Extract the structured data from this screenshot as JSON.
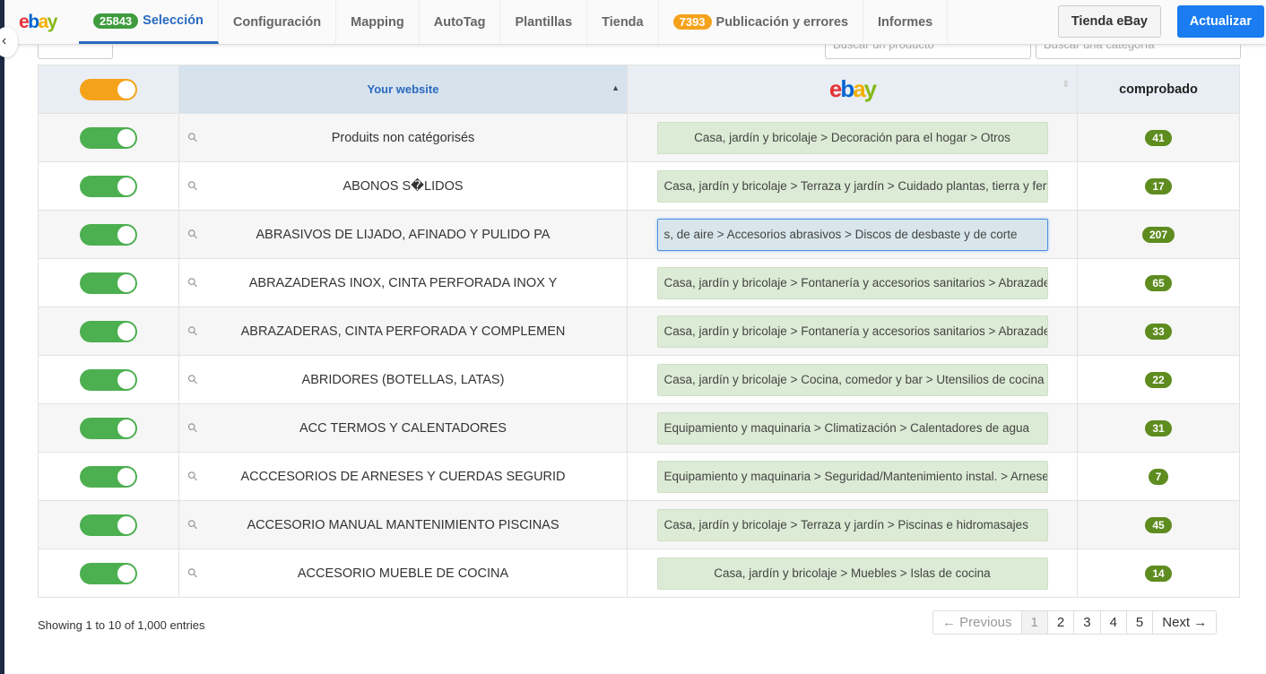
{
  "nav": {
    "logo": "ebay",
    "tabs": [
      {
        "label": "Selección",
        "badge": "25843",
        "badge_color": "#3e9b3e",
        "active": true
      },
      {
        "label": "Configuración"
      },
      {
        "label": "Mapping"
      },
      {
        "label": "AutoTag"
      },
      {
        "label": "Plantillas"
      },
      {
        "label": "Tienda"
      },
      {
        "label": "Publicación y errores",
        "badge": "7393",
        "badge_color": "#f5a21b"
      },
      {
        "label": "Informes"
      }
    ],
    "store_button": "Tienda eBay",
    "update_button": "Actualizar"
  },
  "search": {
    "product_placeholder": "Buscar un producto",
    "category_placeholder": "Buscar una categoría"
  },
  "table": {
    "header": {
      "site": "Your website",
      "ebay": "ebay",
      "checked": "comprobado"
    },
    "rows": [
      {
        "name": "Produits non catégorisés",
        "category": "Casa, jardín y bricolaje > Decoración para el hogar > Otros",
        "count": "41"
      },
      {
        "name": "ABONOS S�LIDOS",
        "category": "Casa, jardín y bricolaje > Terraza y jardín > Cuidado plantas, tierra y fertilizantes",
        "count": "17"
      },
      {
        "name": "ABRASIVOS DE LIJADO, AFINADO Y PULIDO PA",
        "category": "s, de aire > Accesorios abrasivos > Discos de desbaste y de corte",
        "count": "207"
      },
      {
        "name": "ABRAZADERAS INOX, CINTA PERFORADA INOX Y",
        "category": "Casa, jardín y bricolaje > Fontanería y accesorios sanitarios > Abrazaderas",
        "count": "65"
      },
      {
        "name": "ABRAZADERAS, CINTA PERFORADA Y COMPLEMEN",
        "category": "Casa, jardín y bricolaje > Fontanería y accesorios sanitarios > Abrazaderas",
        "count": "33"
      },
      {
        "name": "ABRIDORES (BOTELLAS, LATAS)",
        "category": "Casa, jardín y bricolaje > Cocina, comedor y bar > Utensilios de cocina",
        "count": "22"
      },
      {
        "name": "ACC TERMOS Y CALENTADORES",
        "category": "Equipamiento y maquinaria > Climatización > Calentadores de agua",
        "count": "31"
      },
      {
        "name": "ACCCESORIOS DE ARNESES Y CUERDAS SEGURID",
        "category": "Equipamiento y maquinaria > Seguridad/Mantenimiento instal. > Arneses",
        "count": "7"
      },
      {
        "name": "ACCESORIO MANUAL MANTENIMIENTO PISCINAS",
        "category": "Casa, jardín y bricolaje > Terraza y jardín > Piscinas e hidromasajes",
        "count": "45"
      },
      {
        "name": "ACCESORIO MUEBLE DE COCINA",
        "category": "Casa, jardín y bricolaje > Muebles > Islas de cocina",
        "count": "14"
      }
    ]
  },
  "footer": {
    "info": "Showing 1 to 10 of 1,000 entries",
    "previous": "← Previous",
    "pages": [
      "1",
      "2",
      "3",
      "4",
      "5"
    ],
    "current_page": "1",
    "next": "Next →"
  }
}
